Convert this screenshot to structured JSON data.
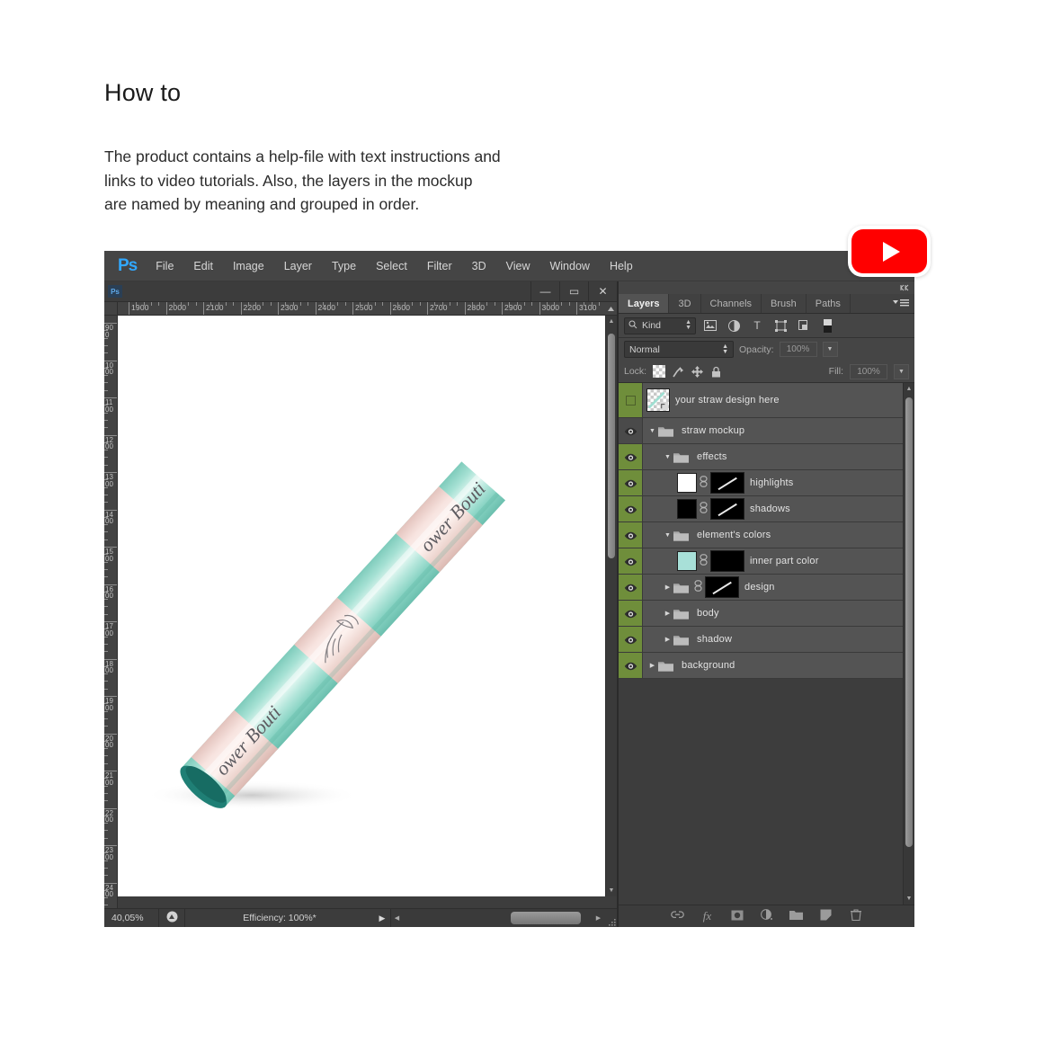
{
  "intro": {
    "title": "How to",
    "paragraph_lines": [
      "The product contains a help-file with text instructions and",
      "links to video tutorials. Also, the layers in the mockup",
      "are named by meaning and grouped in order."
    ]
  },
  "youtube": {
    "label": "play-video",
    "color": "#ff0000"
  },
  "app": {
    "logo": "Ps",
    "menu": [
      "File",
      "Edit",
      "Image",
      "Layer",
      "Type",
      "Select",
      "Filter",
      "3D",
      "View",
      "Window",
      "Help"
    ]
  },
  "document_window": {
    "badge": "Ps",
    "window_buttons": [
      {
        "name": "minimize",
        "glyph": "—"
      },
      {
        "name": "maximize",
        "glyph": "▭"
      },
      {
        "name": "close",
        "glyph": "✕"
      }
    ],
    "ruler_horizontal": [
      "1900",
      "2000",
      "2100",
      "2200",
      "2300",
      "2400",
      "2500",
      "2600",
      "2700",
      "2800",
      "2900",
      "3000",
      "3100"
    ],
    "ruler_vertical": [
      "900",
      "1000",
      "1100",
      "1200",
      "1300",
      "1400",
      "1500",
      "1600",
      "1700",
      "1800",
      "1900",
      "2000",
      "2100",
      "2200",
      "2300",
      "2400"
    ],
    "canvas_origin_label": "0"
  },
  "status_bar": {
    "zoom": "40,05%",
    "efficiency": "Efficiency: 100%*"
  },
  "artwork": {
    "description": "mint straw with pink ribbon stripes",
    "brand_text_upper": "ower Bouti",
    "brand_text_lower": "ower Bouti",
    "colors": {
      "straw_mint": "#9fe0d2",
      "straw_mint_light": "#c9f0e8",
      "straw_mint_dark": "#71c6b5",
      "ribbon_pink": "#f6e0dc",
      "ribbon_pink_dark": "#e7c9c3",
      "tip_teal": "#1f7f75",
      "script_ink": "#5d5b60"
    }
  },
  "panel": {
    "tabs": [
      {
        "label": "Layers",
        "active": true
      },
      {
        "label": "3D",
        "active": false
      },
      {
        "label": "Channels",
        "active": false
      },
      {
        "label": "Brush",
        "active": false
      },
      {
        "label": "Paths",
        "active": false
      }
    ],
    "filter": {
      "kind_label": "Kind",
      "icons": [
        "pixel-filter-icon",
        "adjustment-filter-icon",
        "type-filter-icon",
        "shape-filter-icon",
        "smart-object-filter-icon",
        "toggle-filter-icon"
      ]
    },
    "blend": {
      "mode": "Normal",
      "opacity_label": "Opacity:",
      "opacity_value": "100%"
    },
    "lock": {
      "label": "Lock:",
      "icons": [
        "lock-transparency-icon",
        "lock-image-icon",
        "lock-position-icon",
        "lock-all-icon"
      ],
      "fill_label": "Fill:",
      "fill_value": "100%"
    },
    "layers": [
      {
        "name": "your straw design here",
        "visible": false,
        "eye_column": "green",
        "indent": 0,
        "type": "smart-object",
        "thumb": "checker",
        "expandable": false
      },
      {
        "name": "straw mockup",
        "visible": true,
        "eye_column": "dark",
        "indent": 0,
        "type": "group",
        "expanded": true,
        "expandable": true
      },
      {
        "name": "effects",
        "visible": true,
        "eye_column": "green",
        "indent": 1,
        "type": "group",
        "expanded": true,
        "expandable": true
      },
      {
        "name": "highlights",
        "visible": true,
        "eye_column": "green",
        "indent": 2,
        "type": "fill",
        "swatch": "#ffffff",
        "linked": true,
        "mask": "black-with-diagonal",
        "expandable": false
      },
      {
        "name": "shadows",
        "visible": true,
        "eye_column": "green",
        "indent": 2,
        "type": "fill",
        "swatch": "#000000",
        "linked": true,
        "mask": "black-with-diagonal",
        "expandable": false
      },
      {
        "name": "element's colors",
        "visible": true,
        "eye_column": "green",
        "indent": 1,
        "type": "group",
        "expanded": true,
        "expandable": true
      },
      {
        "name": "inner part color",
        "visible": true,
        "eye_column": "green",
        "indent": 2,
        "type": "fill",
        "swatch": "#a8e0d8",
        "linked": true,
        "mask": "black",
        "expandable": false
      },
      {
        "name": "design",
        "visible": true,
        "eye_column": "green",
        "indent": 1,
        "type": "group",
        "expanded": false,
        "expandable": true,
        "linked": true,
        "mask": "black-with-diagonal"
      },
      {
        "name": "body",
        "visible": true,
        "eye_column": "green",
        "indent": 1,
        "type": "group",
        "expanded": false,
        "expandable": true
      },
      {
        "name": "shadow",
        "visible": true,
        "eye_column": "green",
        "indent": 1,
        "type": "group",
        "expanded": false,
        "expandable": true
      },
      {
        "name": "background",
        "visible": true,
        "eye_column": "green",
        "indent": 0,
        "type": "group",
        "expanded": false,
        "expandable": true
      }
    ],
    "bottom_icons": [
      "link-layers-icon",
      "layer-style-fx-icon",
      "add-mask-icon",
      "adjustment-layer-icon",
      "new-group-icon",
      "new-layer-icon",
      "delete-layer-icon"
    ]
  }
}
